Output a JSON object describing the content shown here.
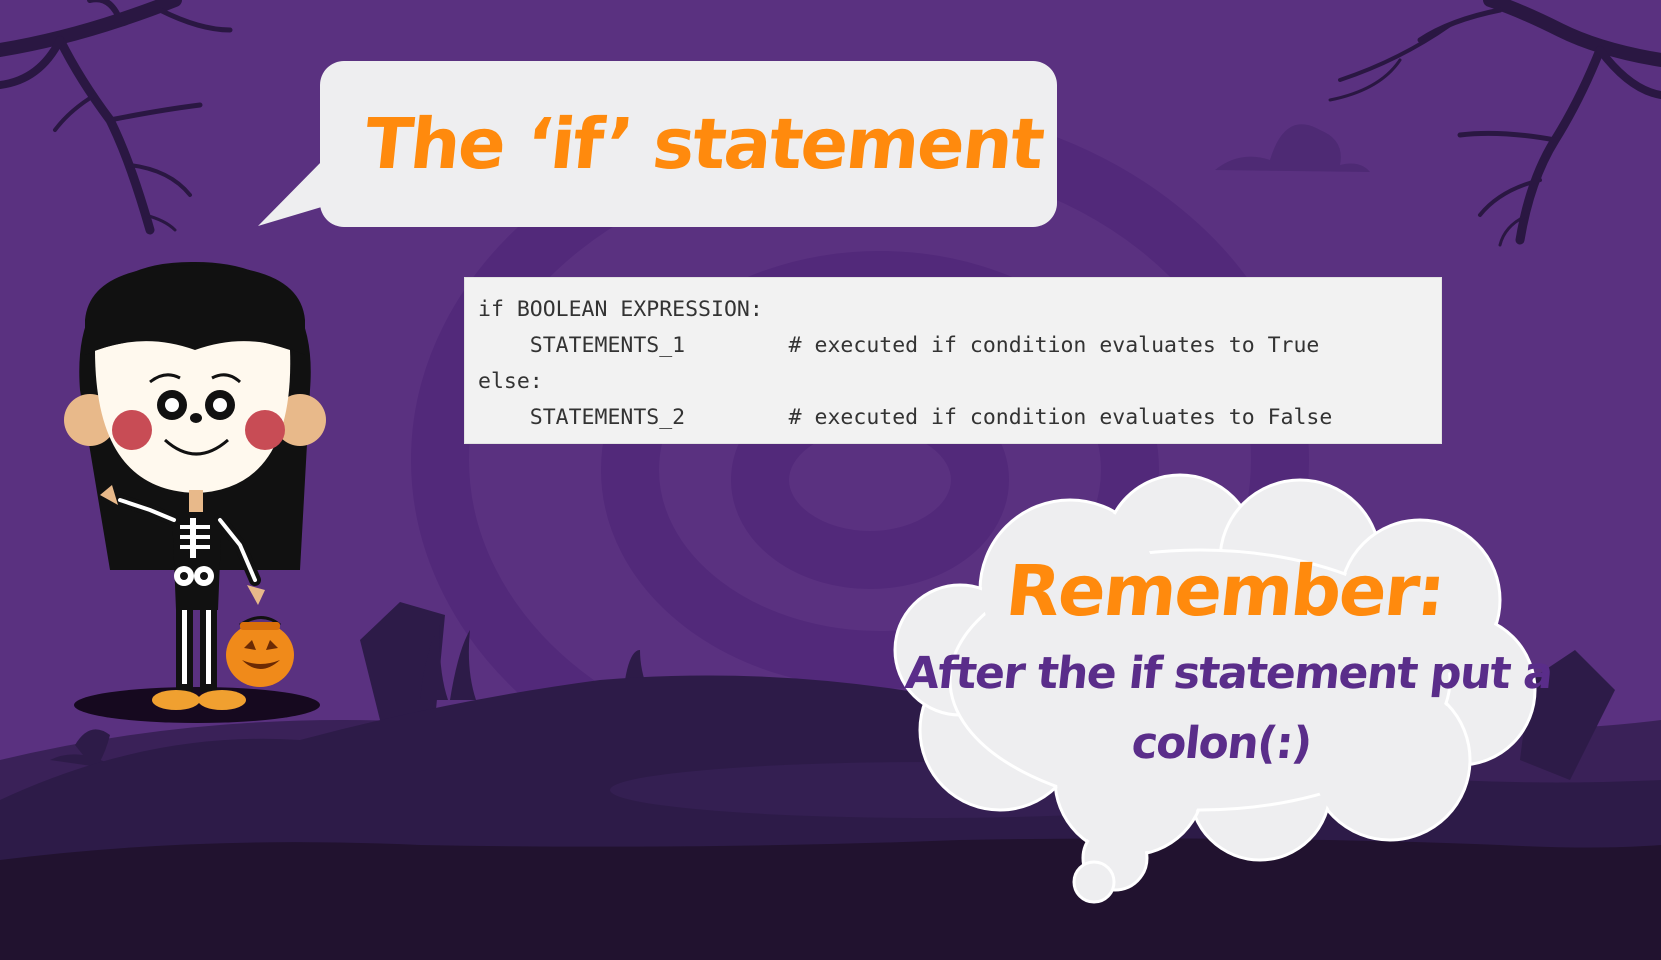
{
  "slide": {
    "title": "The ‘if’ statement",
    "code_lines": [
      "if BOOLEAN EXPRESSION:",
      "    STATEMENTS_1        # executed if condition evaluates to True",
      "else:",
      "    STATEMENTS_2        # executed if condition evaluates to False"
    ],
    "remember_heading": "Remember:",
    "remember_text": "After the if statement put a colon(:)"
  },
  "colors": {
    "background": "#5a3180",
    "hill_dark": "#2d1b48",
    "ground_darkest": "#21122f",
    "accent_orange": "#ff8a0d",
    "text_purple": "#5a2d8a",
    "bubble_gray": "#eeeef0"
  },
  "illustration": {
    "character": "girl-in-skeleton-costume-icon",
    "pumpkin": "jack-o-lantern-bucket-icon",
    "trees": "bare-spooky-tree-icon"
  }
}
